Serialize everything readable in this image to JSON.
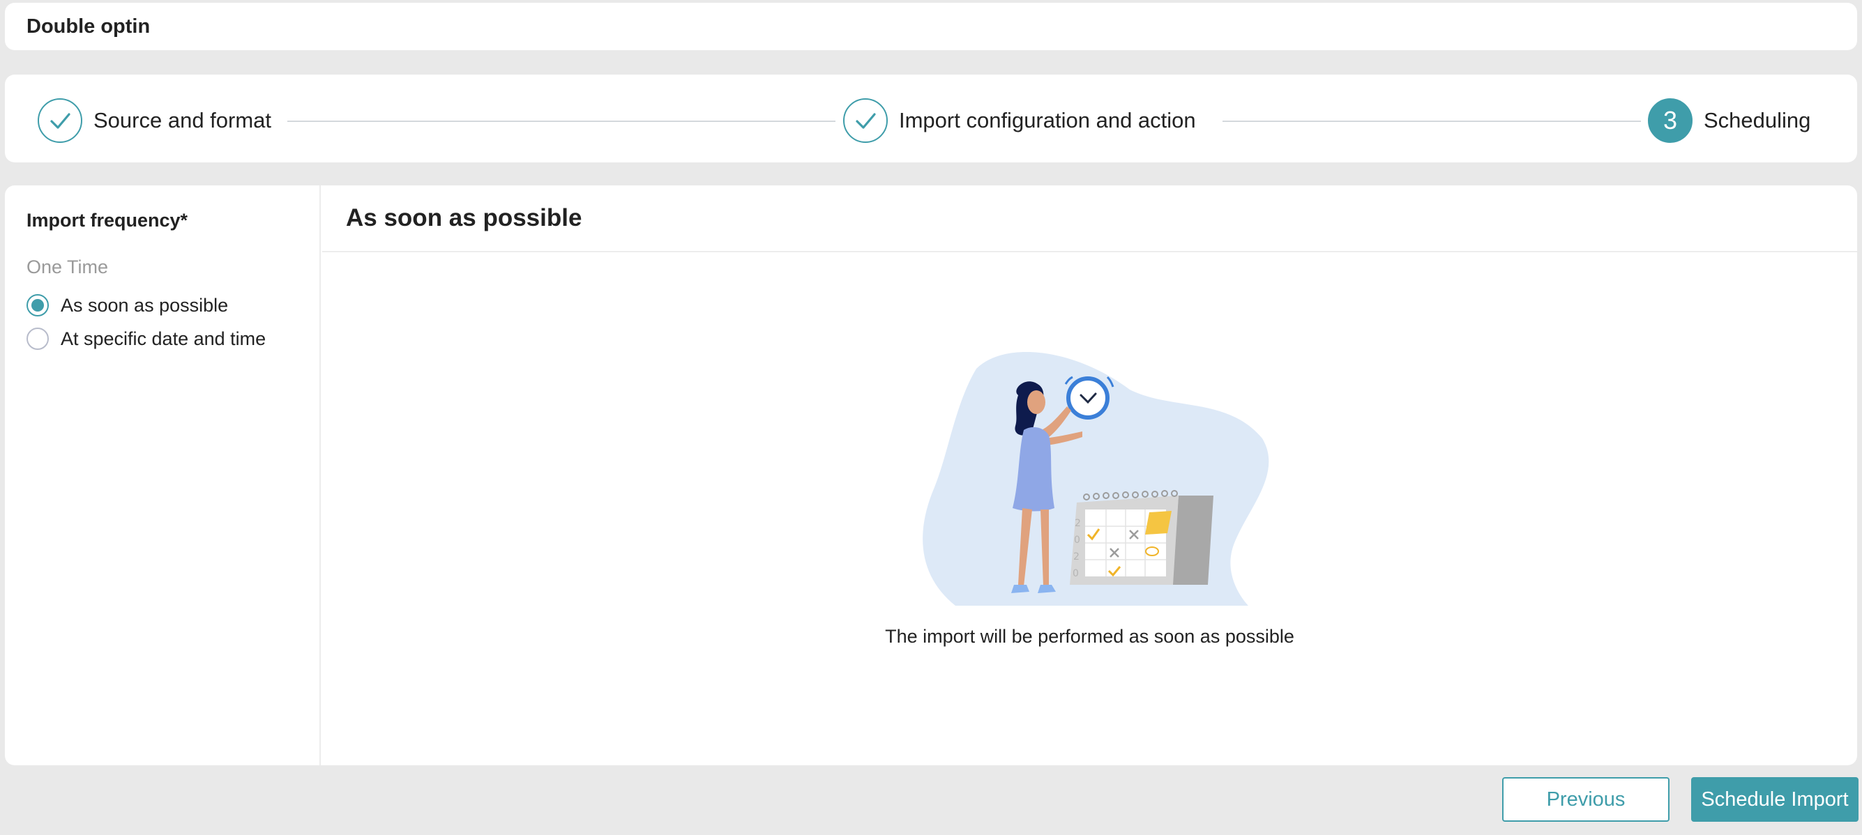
{
  "header": {
    "title": "Double optin"
  },
  "stepper": {
    "steps": [
      {
        "label": "Source and format",
        "state": "completed",
        "icon": "check-icon"
      },
      {
        "label": "Import configuration and action",
        "state": "completed",
        "icon": "check-icon"
      },
      {
        "label": "Scheduling",
        "state": "active",
        "number": "3"
      }
    ]
  },
  "sidebar": {
    "frequency_label": "Import frequency*",
    "group_label": "One Time",
    "options": [
      {
        "label": "As soon as possible",
        "selected": true
      },
      {
        "label": "At specific date and time",
        "selected": false
      }
    ]
  },
  "content": {
    "title": "As soon as possible",
    "illustration": "woman-with-clock-and-calendar-illustration",
    "caption": "The import will be performed as soon as possible"
  },
  "footer": {
    "previous_label": "Previous",
    "schedule_label": "Schedule Import"
  },
  "colors": {
    "accent": "#3f9daa",
    "background": "#e9e9e9",
    "card": "#ffffff"
  }
}
